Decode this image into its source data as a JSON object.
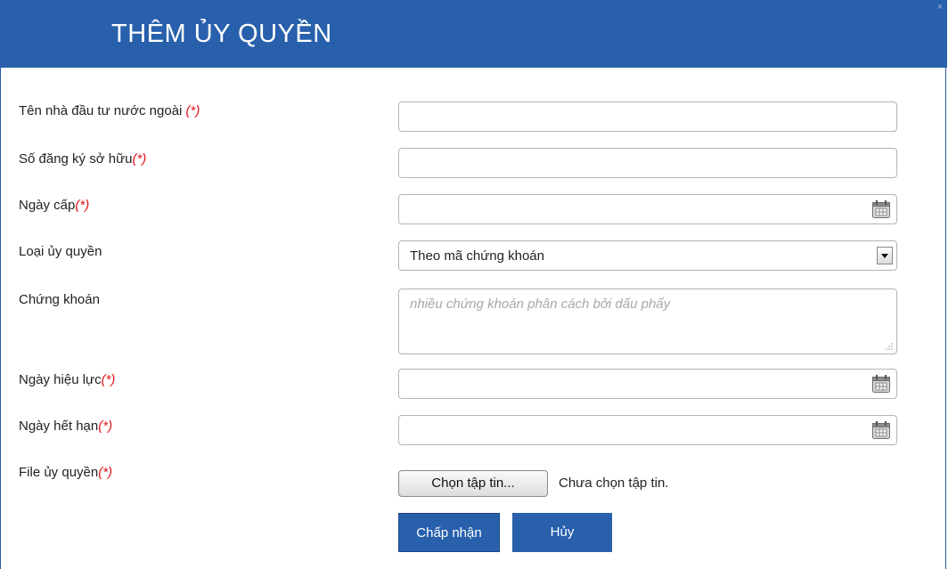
{
  "dialog": {
    "title": "THÊM ỦY QUYỀN",
    "close_symbol": "×"
  },
  "form": {
    "required_marker": "(*)",
    "investor_name": {
      "label": "Tên nhà đầu tư nước ngoài ",
      "value": ""
    },
    "ownership_number": {
      "label": "Số đăng ký sở hữu",
      "value": ""
    },
    "issue_date": {
      "label": "Ngày cấp",
      "value": "",
      "icon": "calendar-icon"
    },
    "authorization_type": {
      "label": "Loại ủy quyền",
      "selected": "Theo mã chứng khoán"
    },
    "securities": {
      "label": "Chứng khoán",
      "placeholder": "nhiều chứng khoán phân cách bởi dấu phẩy"
    },
    "effective_date": {
      "label": "Ngày hiệu lực",
      "value": "",
      "icon": "calendar-icon"
    },
    "expiry_date": {
      "label": "Ngày hết hạn",
      "value": "",
      "icon": "calendar-icon"
    },
    "authorization_file": {
      "label": "File ủy quyền",
      "button": "Chọn tập tin...",
      "status": "Chưa chọn tập tin."
    }
  },
  "actions": {
    "accept": "Chấp nhận",
    "cancel": "Hủy"
  },
  "colors": {
    "header": "#2860ac",
    "required": "#e0161b",
    "button": "#2860ac"
  }
}
